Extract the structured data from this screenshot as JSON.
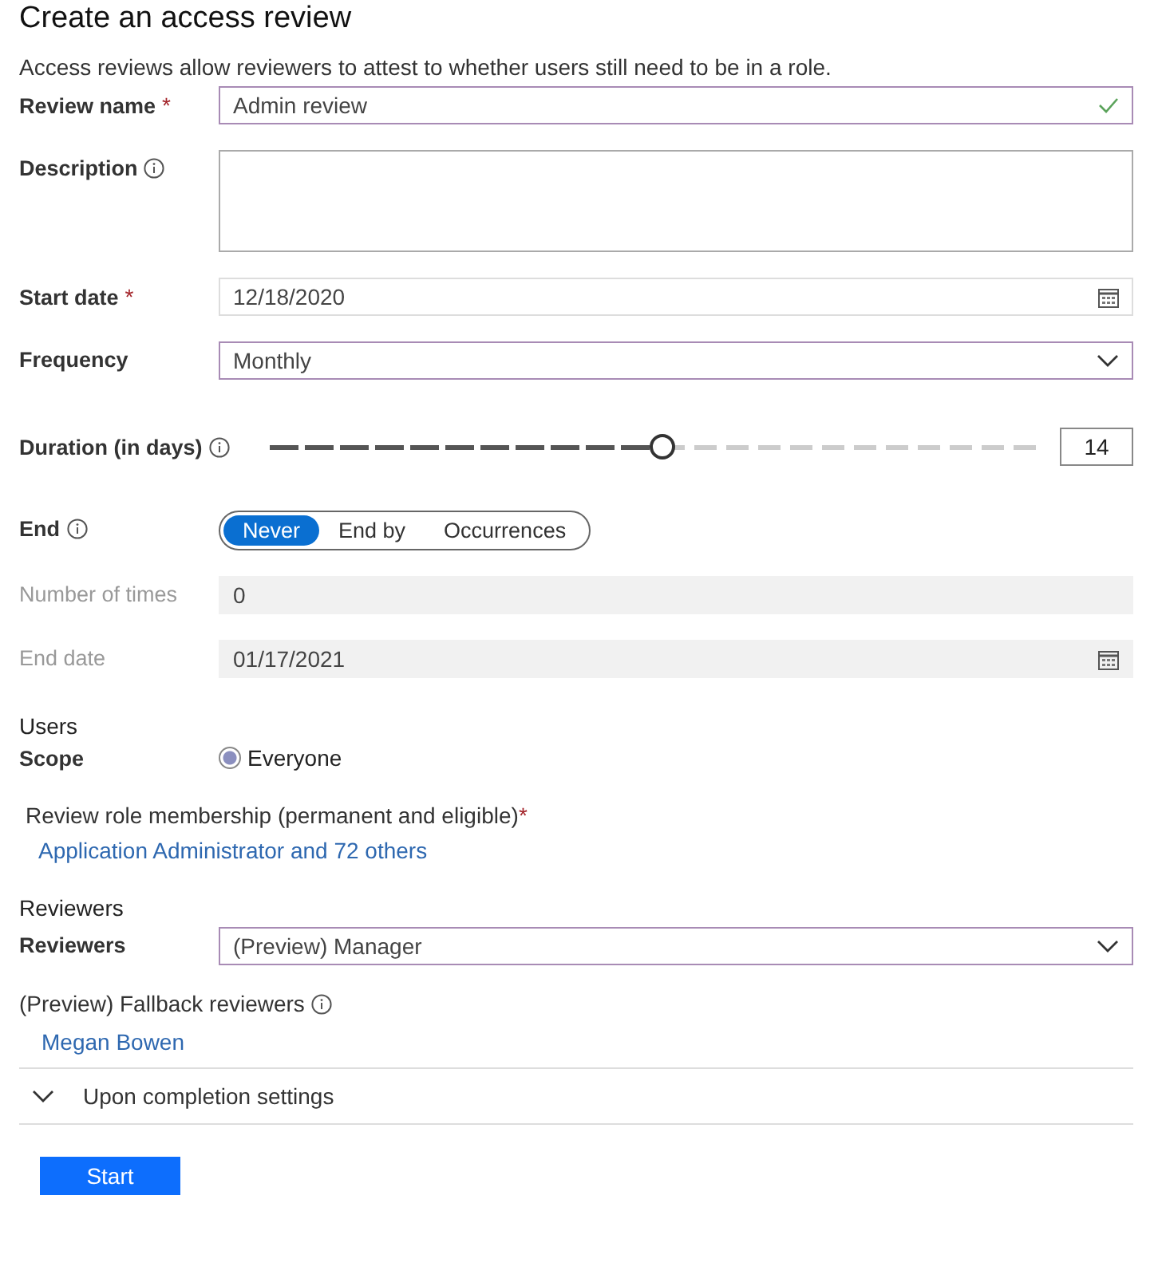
{
  "title": "Create an access review",
  "intro": "Access reviews allow reviewers to attest to whether users still need to be in a role.",
  "fields": [
    {
      "kind": "text",
      "label": "Review name",
      "required_mark": "*",
      "value": "Admin review",
      "valid": true
    },
    {
      "kind": "textarea",
      "label": "Description",
      "info": true
    },
    {
      "kind": "date",
      "label": "Start date",
      "required_mark": "*",
      "value": "12/18/2020"
    },
    {
      "kind": "select",
      "label": "Frequency",
      "value": "Monthly"
    },
    {
      "kind": "slider",
      "label": "Duration (in days)",
      "info": true,
      "level": 0.51,
      "value": "14"
    },
    {
      "kind": "segmented",
      "label": "End",
      "info": true,
      "options": [
        {
          "label": "Never",
          "selected": true
        },
        {
          "label": "End by",
          "selected": false
        },
        {
          "label": "Occurrences",
          "selected": false
        }
      ]
    },
    {
      "kind": "text",
      "label": "Number of times",
      "value": "0",
      "disabled": true
    },
    {
      "kind": "date",
      "label": "End date",
      "value": "01/17/2021",
      "disabled": true
    }
  ],
  "users": {
    "heading": "Users",
    "scope_label": "Scope",
    "scope_options": [
      {
        "label": "Everyone",
        "selected": true
      }
    ],
    "role_label": "Review role membership (permanent and eligible)",
    "role_required_mark": "*",
    "role_link": "Application Administrator and 72 others"
  },
  "reviewers": {
    "heading": "Reviewers",
    "label": "Reviewers",
    "value": "(Preview) Manager",
    "fallback_label": "(Preview) Fallback reviewers",
    "fallback_info": true,
    "fallback_link": "Megan Bowen"
  },
  "completion": {
    "label": "Upon completion settings",
    "expanded": false
  },
  "start_button": "Start"
}
